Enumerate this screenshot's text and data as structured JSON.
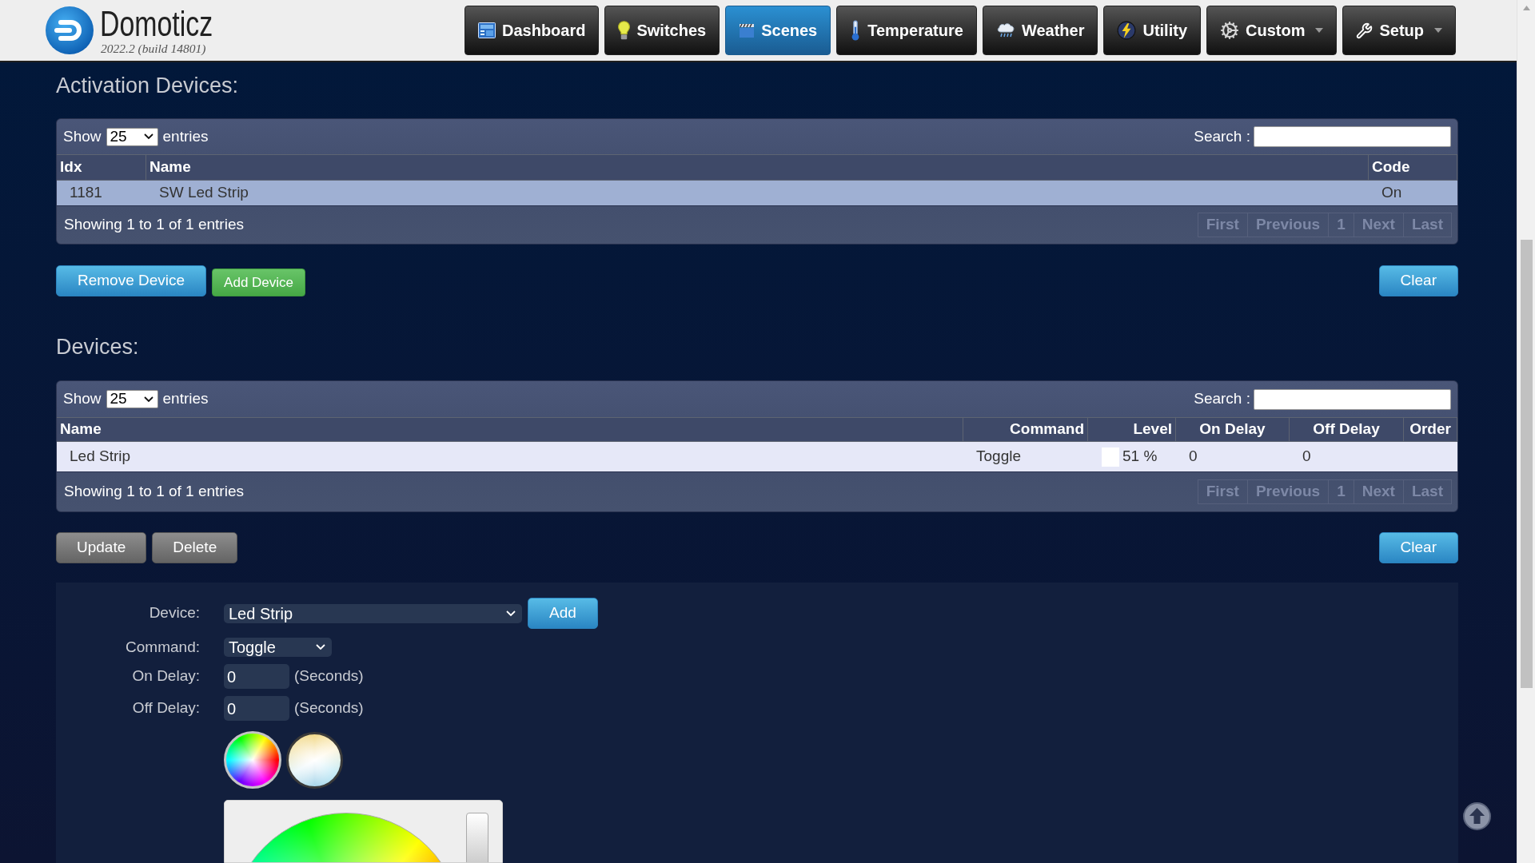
{
  "header": {
    "logo_text": "Domoticz",
    "version": "2022.2 (build 14801)",
    "nav": [
      {
        "label": "Dashboard",
        "selected": false,
        "dropdown": false
      },
      {
        "label": "Switches",
        "selected": false,
        "dropdown": false
      },
      {
        "label": "Scenes",
        "selected": true,
        "dropdown": false
      },
      {
        "label": "Temperature",
        "selected": false,
        "dropdown": false
      },
      {
        "label": "Weather",
        "selected": false,
        "dropdown": false
      },
      {
        "label": "Utility",
        "selected": false,
        "dropdown": false
      },
      {
        "label": "Custom",
        "selected": false,
        "dropdown": true
      },
      {
        "label": "Setup",
        "selected": false,
        "dropdown": true
      }
    ]
  },
  "activation": {
    "title": "Activation Devices:",
    "table": {
      "show_label": "Show",
      "page_size": "25",
      "entries_label": "entries",
      "search_label": "Search :",
      "columns": [
        "Idx",
        "Name",
        "Code"
      ],
      "rows": [
        {
          "selected": true,
          "cells": [
            {
              "text": "1181"
            },
            {
              "text": "SW Led Strip"
            },
            {
              "text": "On"
            }
          ]
        }
      ],
      "info": "Showing 1 to 1 of 1 entries",
      "pagination": [
        {
          "label": "First",
          "disabled": true
        },
        {
          "label": "Previous",
          "disabled": true
        },
        {
          "label": "1",
          "disabled": true
        },
        {
          "label": "Next",
          "disabled": true
        },
        {
          "label": "Last",
          "disabled": true
        }
      ]
    },
    "buttons": [
      {
        "label": "Remove Device",
        "kind": "primary",
        "disabled": false
      },
      {
        "label": "Add Device",
        "kind": "success",
        "disabled": false
      }
    ],
    "right_buttons": [
      {
        "label": "Clear",
        "kind": "primary",
        "disabled": false
      }
    ]
  },
  "devices": {
    "title": "Devices:",
    "table": {
      "show_label": "Show",
      "page_size": "25",
      "entries_label": "entries",
      "search_label": "Search :",
      "columns": [
        "Name",
        "Command",
        "Level",
        "On Delay",
        "Off Delay",
        "Order"
      ],
      "rows": [
        {
          "selected": false,
          "cells": [
            {
              "text": "Led Strip"
            },
            {
              "text": "Toggle"
            },
            {
              "text": "51 %",
              "color": "#ffffff"
            },
            {
              "text": "0"
            },
            {
              "text": "0"
            }
          ]
        }
      ],
      "info": "Showing 1 to 1 of 1 entries",
      "pagination": [
        {
          "label": "First",
          "disabled": true
        },
        {
          "label": "Previous",
          "disabled": true
        },
        {
          "label": "1",
          "disabled": true
        },
        {
          "label": "Next",
          "disabled": true
        },
        {
          "label": "Last",
          "disabled": true
        }
      ]
    },
    "buttons": [
      {
        "label": "Update",
        "kind": "primary",
        "disabled": true
      },
      {
        "label": "Delete",
        "kind": "primary",
        "disabled": true
      }
    ],
    "right_buttons": [
      {
        "label": "Clear",
        "kind": "primary",
        "disabled": false
      }
    ]
  },
  "editor": {
    "fields": [
      {
        "label": "Device:",
        "kind": "select",
        "value": "Led Strip",
        "button": {
          "label": "Add",
          "kind": "primary",
          "disabled": false
        }
      },
      {
        "label": "Command:",
        "kind": "select",
        "value": "Toggle"
      },
      {
        "label": "On Delay:",
        "kind": "number",
        "value": "0",
        "unit": "(Seconds)"
      },
      {
        "label": "Off Delay:",
        "kind": "number",
        "value": "0",
        "unit": "(Seconds)"
      }
    ],
    "color_modes": [
      {
        "kind": "rgb",
        "selected": true
      },
      {
        "kind": "white",
        "selected": false
      }
    ]
  }
}
